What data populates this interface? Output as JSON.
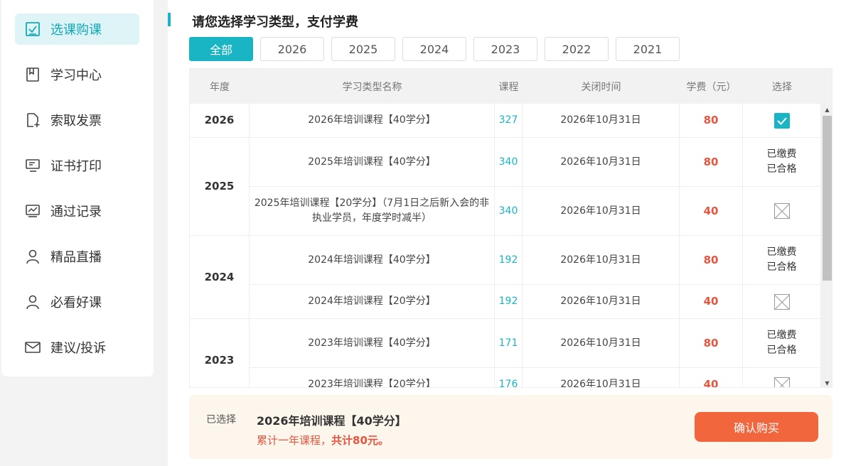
{
  "sidebar": {
    "items": [
      {
        "label": "选课购课",
        "icon": "checkbox-icon",
        "active": true
      },
      {
        "label": "学习中心",
        "icon": "book-icon",
        "active": false
      },
      {
        "label": "索取发票",
        "icon": "invoice-add-icon",
        "active": false
      },
      {
        "label": "证书打印",
        "icon": "certificate-icon",
        "active": false
      },
      {
        "label": "通过记录",
        "icon": "chart-icon",
        "active": false
      },
      {
        "label": "精品直播",
        "icon": "user-icon",
        "active": false
      },
      {
        "label": "必看好课",
        "icon": "user-icon",
        "active": false
      },
      {
        "label": "建议/投诉",
        "icon": "mail-icon",
        "active": false
      }
    ]
  },
  "main": {
    "title": "请您选择学习类型，支付学费",
    "tabs": [
      "全部",
      "2026",
      "2025",
      "2024",
      "2023",
      "2022",
      "2021"
    ],
    "active_tab": 0
  },
  "table": {
    "headers": [
      "年度",
      "学习类型名称",
      "课程",
      "关闭时间",
      "学费（元）",
      "选择"
    ],
    "groups": [
      {
        "year": "2026",
        "rows": [
          {
            "name": "2026年培训课程【40学分】",
            "courses": "327",
            "close": "2026年10月31日",
            "fee": "80",
            "status": "checked"
          }
        ]
      },
      {
        "year": "2025",
        "rows": [
          {
            "name": "2025年培训课程【40学分】",
            "courses": "340",
            "close": "2026年10月31日",
            "fee": "80",
            "status": "paid",
            "paid": "已缴费",
            "passed": "已合格"
          },
          {
            "name": "2025年培训课程【20学分】（7月1日之后新入会的非执业学员，年度学时减半）",
            "courses": "340",
            "close": "2026年10月31日",
            "fee": "40",
            "status": "disabled"
          }
        ]
      },
      {
        "year": "2024",
        "rows": [
          {
            "name": "2024年培训课程【40学分】",
            "courses": "192",
            "close": "2026年10月31日",
            "fee": "80",
            "status": "paid",
            "paid": "已缴费",
            "passed": "已合格"
          },
          {
            "name": "2024年培训课程【20学分】",
            "courses": "192",
            "close": "2026年10月31日",
            "fee": "40",
            "status": "disabled"
          }
        ]
      },
      {
        "year": "2023",
        "rows": [
          {
            "name": "2023年培训课程【40学分】",
            "courses": "171",
            "close": "2026年10月31日",
            "fee": "80",
            "status": "paid",
            "paid": "已缴费",
            "passed": "已合格"
          },
          {
            "name": "2023年培训课程【20学分】",
            "courses": "176",
            "close": "2026年10月31日",
            "fee": "40",
            "status": "disabled"
          }
        ]
      }
    ]
  },
  "footer": {
    "selected_label": "已选择",
    "selected_course": "2026年培训课程【40学分】",
    "summary_prefix": "累计一年课程，",
    "summary_total": "共计80元。",
    "confirm_label": "确认购买"
  },
  "colors": {
    "accent": "#19b5c5",
    "fee": "#e8553e",
    "button": "#f2663d"
  }
}
